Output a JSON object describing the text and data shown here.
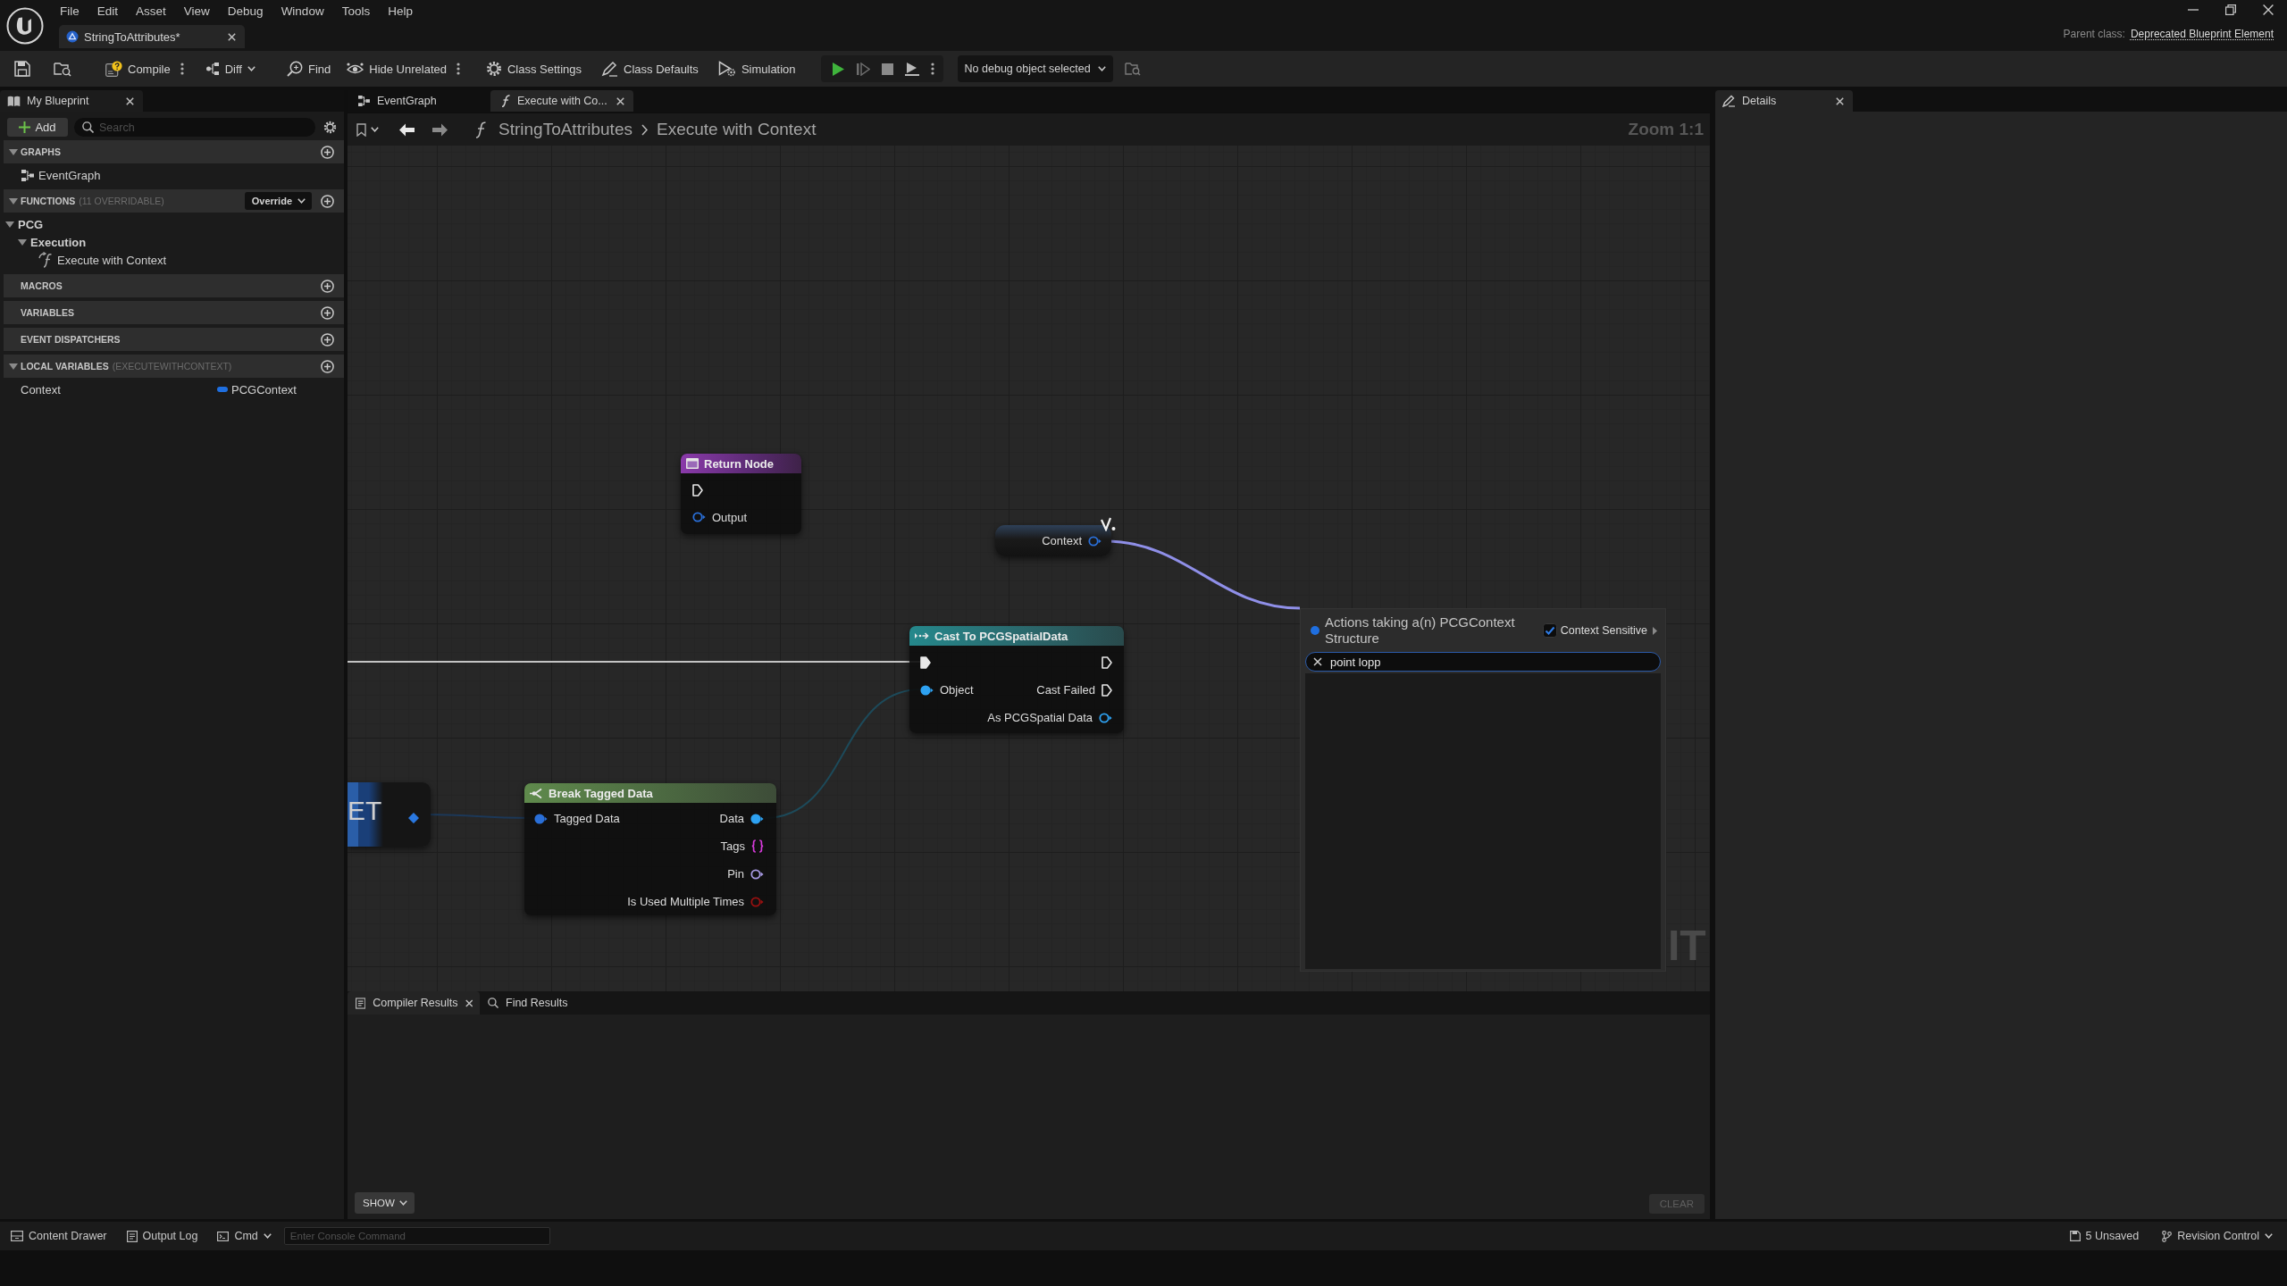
{
  "menu_bar": [
    "File",
    "Edit",
    "Asset",
    "View",
    "Debug",
    "Window",
    "Tools",
    "Help"
  ],
  "asset_tabs": [
    {
      "label": "StringToAttributes*",
      "selected": true
    }
  ],
  "parent_class": {
    "label": "Parent class:",
    "value": "Deprecated Blueprint Element"
  },
  "toolbar": {
    "buttons": [
      {
        "label": "Compile",
        "dropdown": false,
        "more": true
      },
      {
        "label": "Diff",
        "dropdown": true,
        "more": false
      },
      {
        "label": "Find",
        "dropdown": false,
        "more": false
      },
      {
        "label": "Hide Unrelated",
        "dropdown": false,
        "more": true
      },
      {
        "label": "Class Settings",
        "dropdown": false,
        "more": false
      },
      {
        "label": "Class Defaults",
        "dropdown": false,
        "more": false
      },
      {
        "label": "Simulation",
        "dropdown": false,
        "more": false
      }
    ],
    "debug_filter": "No debug object selected"
  },
  "my_blueprint": {
    "tab": "My Blueprint",
    "add_button": "Add",
    "search": {
      "placeholder": "Search"
    },
    "sections": [
      {
        "title": "GRAPHS",
        "expanded": true,
        "items": [
          {
            "label": "EventGraph",
            "kind": "graph"
          }
        ]
      },
      {
        "title": "FUNCTIONS",
        "note": "(11 OVERRIDABLE)",
        "dropdown": "Override",
        "expanded": true,
        "items": [
          {
            "label": "PCG",
            "kind": "category",
            "expanded": true,
            "children": [
              {
                "label": "Execution",
                "kind": "category",
                "expanded": true,
                "children": [
                  {
                    "label": "Execute with Context",
                    "kind": "function"
                  }
                ]
              }
            ]
          }
        ]
      },
      {
        "title": "MACROS",
        "expanded": false
      },
      {
        "title": "VARIABLES",
        "expanded": false
      },
      {
        "title": "EVENT DISPATCHERS",
        "expanded": false
      },
      {
        "title": "LOCAL VARIABLES",
        "note": "(EXECUTEWITHCONTEXT)",
        "expanded": true,
        "items": [
          {
            "label": "Context",
            "kind": "variable",
            "type": "PCGContext"
          }
        ]
      }
    ]
  },
  "document_tabs": [
    {
      "label": "EventGraph",
      "kind": "graph",
      "selected": false
    },
    {
      "label": "Execute with Co...",
      "kind": "function",
      "selected": true
    }
  ],
  "breadcrumb": [
    "StringToAttributes",
    "Execute with Context"
  ],
  "zoom_label": "Zoom 1:1",
  "graph": {
    "nodes": [
      {
        "kind": "return",
        "title": "Return Node",
        "rows": [
          {
            "left": {
              "kind": "exec",
              "connected": false
            }
          },
          {
            "left": {
              "kind": "data",
              "label": "Output",
              "color": "#2a6fd8",
              "connected": false
            }
          }
        ]
      },
      {
        "kind": "variable",
        "rows": [
          {
            "right": {
              "kind": "data",
              "label": "Context",
              "color": "#2a6fd8",
              "connected": false
            }
          }
        ]
      },
      {
        "kind": "cast",
        "title": "Cast To PCGSpatialData",
        "rows": [
          {
            "left": {
              "kind": "exec",
              "connected": true
            },
            "right": {
              "kind": "exec",
              "connected": false
            }
          },
          {
            "left": {
              "kind": "data",
              "label": "Object",
              "color": "#2ea2f2",
              "connected": true
            },
            "right": {
              "kind": "exec",
              "label": "Cast Failed",
              "connected": false
            }
          },
          {
            "right": {
              "kind": "data",
              "label": "As PCGSpatial Data",
              "color": "#2ea2f2",
              "connected": false
            }
          }
        ]
      },
      {
        "kind": "break",
        "title": "Break Tagged Data",
        "rows": [
          {
            "left": {
              "kind": "data",
              "label": "Tagged Data",
              "color": "#2a6fd8",
              "connected": true
            },
            "right": {
              "kind": "data",
              "label": "Data",
              "color": "#2ea2f2",
              "connected": true
            }
          },
          {
            "right": {
              "kind": "container",
              "label": "Tags",
              "color": "#d43ad8",
              "connected": false
            }
          },
          {
            "right": {
              "kind": "data",
              "label": "Pin",
              "color": "#a99be6",
              "connected": false
            }
          },
          {
            "right": {
              "kind": "data",
              "label": "Is Used Multiple Times",
              "color": "#9a1010",
              "connected": false
            }
          }
        ]
      },
      {
        "kind": "compact",
        "title": "ET",
        "rows": [
          {
            "right": {
              "kind": "set",
              "color": "#2a78e0",
              "connected": true
            }
          }
        ]
      }
    ],
    "corner_label": "IT"
  },
  "action_menu": {
    "title": "Actions taking a(n) PCGContext Structure",
    "context_sensitive": {
      "label": "Context Sensitive",
      "checked": true
    },
    "search": {
      "value": "point lopp"
    }
  },
  "details": {
    "tab": "Details"
  },
  "results_panel": {
    "tabs": [
      {
        "label": "Compiler Results",
        "selected": true
      },
      {
        "label": "Find Results",
        "selected": false
      }
    ],
    "show_button": "SHOW",
    "clear_button": {
      "label": "CLEAR",
      "disabled": true
    }
  },
  "status_bar": {
    "content_drawer": "Content Drawer",
    "output_log": "Output Log",
    "cmd": "Cmd",
    "console": {
      "placeholder": "Enter Console Command"
    },
    "unsaved": "5 Unsaved",
    "revision_control": "Revision Control"
  }
}
